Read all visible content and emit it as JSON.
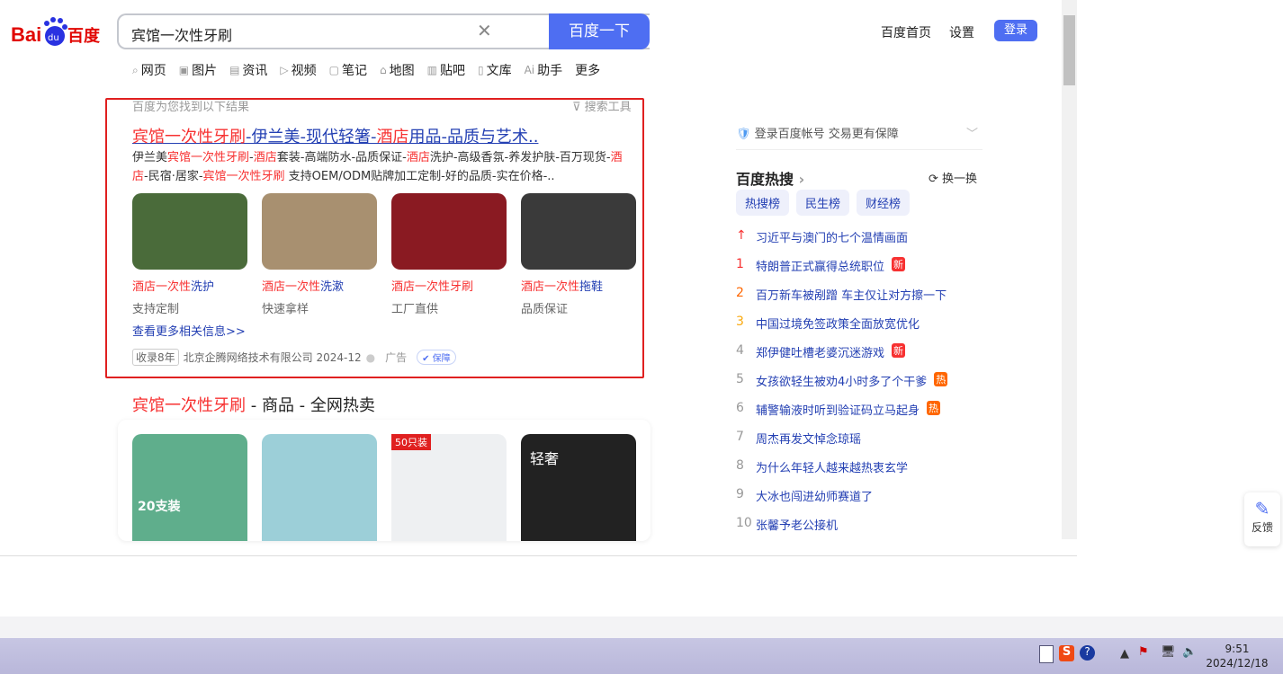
{
  "logo": "Bai度百度",
  "search": {
    "query": "宾馆一次性牙刷",
    "button": "百度一下"
  },
  "topnav": {
    "home": "百度首页",
    "settings": "设置",
    "login": "登录"
  },
  "tabs": [
    "网页",
    "图片",
    "资讯",
    "视频",
    "笔记",
    "地图",
    "贴吧",
    "文库",
    "助手",
    "更多"
  ],
  "hint": "百度为您找到以下结果",
  "tool": "搜索工具",
  "result1": {
    "title": [
      [
        "宾馆一次性牙刷",
        "r"
      ],
      [
        "-伊兰美-现代轻箸-",
        "b"
      ],
      [
        "酒店",
        "r"
      ],
      [
        "用品-品质与艺术..",
        "b"
      ]
    ],
    "desc": [
      [
        "伊兰美",
        ""
      ],
      [
        "宾馆一次性牙刷",
        "r"
      ],
      [
        "-",
        ""
      ],
      [
        "酒店",
        "r"
      ],
      [
        "套装-高端防水-品质保证-",
        ""
      ],
      [
        "酒店",
        "r"
      ],
      [
        "洗护-高级香氛-养发护肤-百万现货-",
        ""
      ],
      [
        "酒店",
        "r"
      ],
      [
        "-民宿·居家-",
        ""
      ],
      [
        "宾馆一次性牙刷",
        "r"
      ],
      [
        " 支持OEM/ODM贴牌加工定制-好的品质-实在价格-..",
        ""
      ]
    ],
    "items": [
      {
        "red": "酒店一次性",
        "blue": "洗护",
        "sub": "支持定制",
        "color": "#4a6b3a"
      },
      {
        "red": "酒店一次性",
        "blue": "洗漱",
        "sub": "快速拿样",
        "color": "#a89070"
      },
      {
        "red": "酒店一次性牙刷",
        "blue": "",
        "sub": "工厂直供",
        "color": "#8a1a22"
      },
      {
        "red": "酒店一次性",
        "blue": "拖鞋",
        "sub": "品质保证",
        "color": "#3a3a3a"
      }
    ],
    "more": "查看更多相关信息>>",
    "tag": "收录8年",
    "source": "北京企腾网络技术有限公司 2024-12",
    "ad": "广告",
    "guarantee": "保障"
  },
  "result2": {
    "title_red": "宾馆一次性牙刷",
    "title_rest": " - 商品 - 全网热卖",
    "labels": [
      "20支装",
      "50只装",
      "轻奢"
    ]
  },
  "right": {
    "login_tip": "登录百度帐号 交易更有保障",
    "hot_title": "百度热搜",
    "swap": "换一换",
    "pills": [
      "热搜榜",
      "民生榜",
      "财经榜"
    ],
    "items": [
      {
        "n": "↑",
        "t": "习近平与澳门的七个温情画面",
        "badge": ""
      },
      {
        "n": "1",
        "t": "特朗普正式赢得总统职位",
        "badge": "新"
      },
      {
        "n": "2",
        "t": "百万新车被剐蹭 车主仅让对方擦一下",
        "badge": ""
      },
      {
        "n": "3",
        "t": "中国过境免签政策全面放宽优化",
        "badge": ""
      },
      {
        "n": "4",
        "t": "郑伊健吐槽老婆沉迷游戏",
        "badge": "新"
      },
      {
        "n": "5",
        "t": "女孩欲轻生被劝4小时多了个干爹",
        "badge": "热"
      },
      {
        "n": "6",
        "t": "辅警输液时听到验证码立马起身",
        "badge": "热"
      },
      {
        "n": "7",
        "t": "周杰再发文悼念琼瑶",
        "badge": ""
      },
      {
        "n": "8",
        "t": "为什么年轻人越来越热衷玄学",
        "badge": ""
      },
      {
        "n": "9",
        "t": "大冰也闯进幼师赛道了",
        "badge": ""
      },
      {
        "n": "10",
        "t": "张馨予老公接机",
        "badge": ""
      }
    ]
  },
  "feedback": "反馈",
  "clock": {
    "time": "9:51",
    "date": "2024/12/18"
  }
}
